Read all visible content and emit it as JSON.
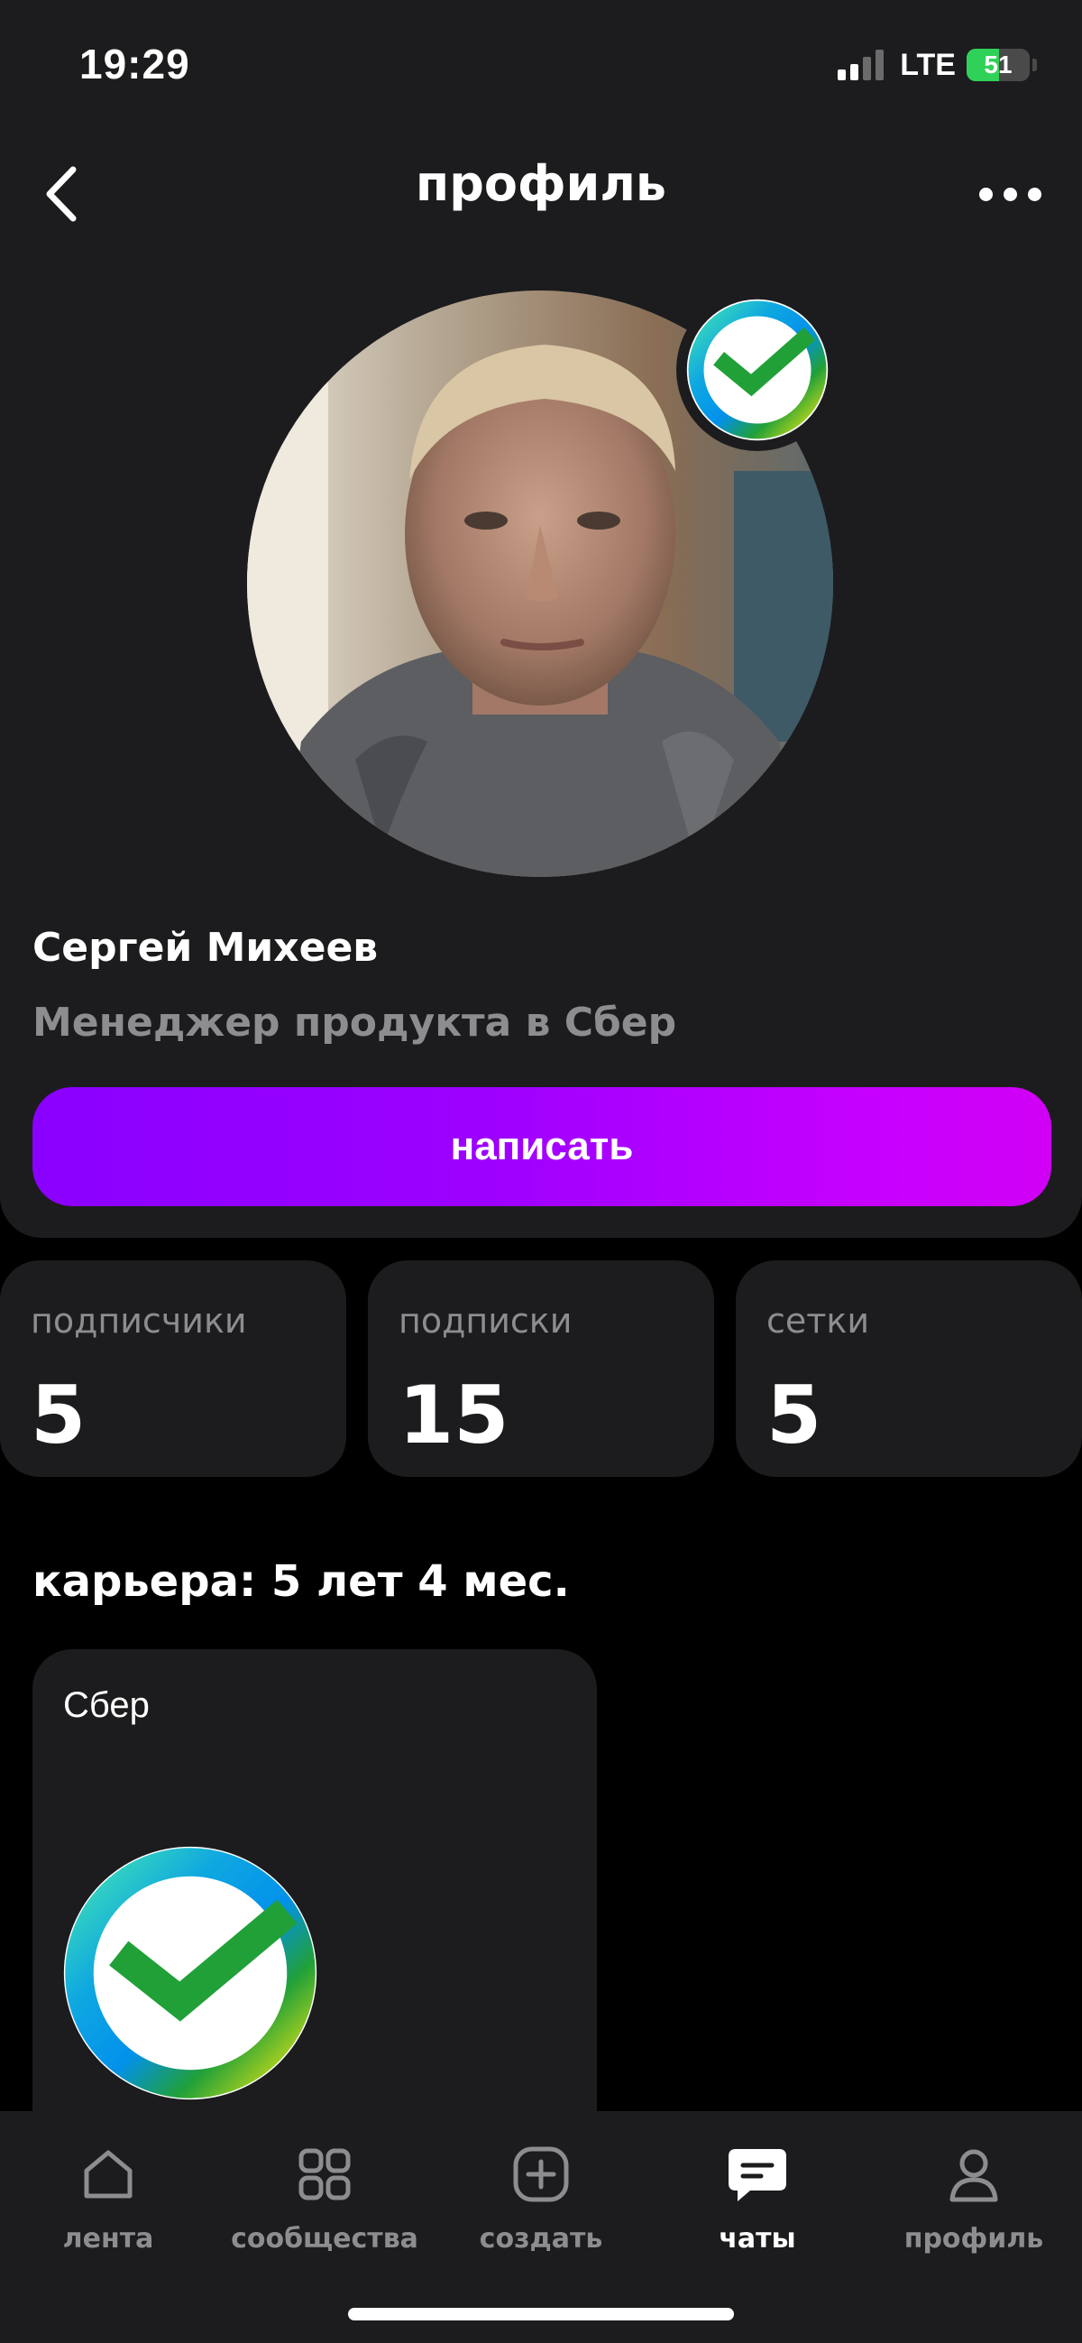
{
  "status_bar": {
    "time": "19:29",
    "network": "LTE",
    "battery": "51",
    "battery_level": 0.51
  },
  "header": {
    "title": "профиль"
  },
  "profile": {
    "name": "Сергей Михеев",
    "role": "Менеджер продукта в Сбер",
    "write_button": "написать"
  },
  "stats": [
    {
      "label": "подписчики",
      "value": "5"
    },
    {
      "label": "подписки",
      "value": "15"
    },
    {
      "label": "сетки",
      "value": "5"
    }
  ],
  "career": {
    "title": "карьера: 5 лет 4 мес.",
    "companies": [
      {
        "name": "Сбер",
        "logo": "sber-logo-icon"
      }
    ]
  },
  "bottom_nav": {
    "active": "чаты",
    "items": [
      {
        "label": "лента",
        "icon": "home-icon"
      },
      {
        "label": "сообщества",
        "icon": "grid-icon"
      },
      {
        "label": "создать",
        "icon": "plus-square-icon"
      },
      {
        "label": "чаты",
        "icon": "chat-icon"
      },
      {
        "label": "профиль",
        "icon": "person-icon"
      }
    ]
  },
  "colors": {
    "background": "#000000",
    "panel": "#1c1c1e",
    "muted_text": "#8d8d8f",
    "accent_gradient_start": "#8a00ff",
    "accent_gradient_end": "#d100f5",
    "sber_green": "#21a038"
  }
}
